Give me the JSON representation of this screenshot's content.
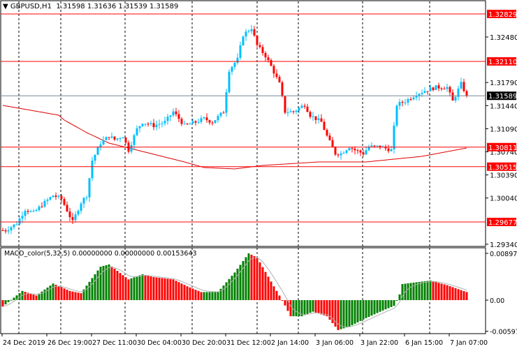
{
  "header": {
    "symbol": "GBPUSD,H1",
    "open": "1.31598",
    "high": "1.31636",
    "low": "1.31539",
    "close": "1.31589"
  },
  "indicator": {
    "label": "MACD_color(5,32,5) 0.00000000 0.00000000 0.00153643"
  },
  "colors": {
    "bull": "#00bfff",
    "bear": "#ff0000",
    "level": "#ff0000",
    "ma": "#e00000",
    "macd_up": "#008000",
    "macd_down": "#ff0000",
    "signal": "#b0b0b0",
    "current": "#778899"
  },
  "chart_data": {
    "type": "candlestick",
    "price_axis": {
      "range": [
        1.2922,
        1.3302
      ],
      "ticks": [
        "1.32480",
        "1.31790",
        "1.31440",
        "1.31090",
        "1.30740",
        "1.30390",
        "1.30040",
        "1.29340"
      ]
    },
    "levels": [
      "1.32829",
      "1.32110",
      "1.30811",
      "1.30515",
      "1.29677"
    ],
    "current_price": "1.31589",
    "price_path": [
      [
        1,
        1.2955
      ],
      [
        5,
        1.29656
      ],
      [
        8,
        1.29867
      ],
      [
        11,
        1.29815
      ],
      [
        15,
        1.29973
      ],
      [
        18,
        1.30079
      ],
      [
        21,
        1.30026
      ],
      [
        25,
        1.29677
      ],
      [
        28,
        1.29973
      ],
      [
        30,
        1.30079
      ],
      [
        32,
        1.30608
      ],
      [
        35,
        1.30872
      ],
      [
        38,
        1.30978
      ],
      [
        40,
        1.30925
      ],
      [
        43,
        1.30978
      ],
      [
        45,
        1.30766
      ],
      [
        48,
        1.31084
      ],
      [
        50,
        1.3119
      ],
      [
        54,
        1.31137
      ],
      [
        58,
        1.3119
      ],
      [
        61,
        1.31348
      ],
      [
        65,
        1.31137
      ],
      [
        69,
        1.3119
      ],
      [
        72,
        1.31242
      ],
      [
        75,
        1.3119
      ],
      [
        79,
        1.31348
      ],
      [
        81,
        1.31983
      ],
      [
        84,
        1.32141
      ],
      [
        86,
        1.32512
      ],
      [
        89,
        1.32617
      ],
      [
        91,
        1.32353
      ],
      [
        94,
        1.32194
      ],
      [
        96,
        1.32036
      ],
      [
        99,
        1.31771
      ],
      [
        101,
        1.31348
      ],
      [
        104,
        1.31348
      ],
      [
        108,
        1.31454
      ],
      [
        110,
        1.31295
      ],
      [
        114,
        1.3119
      ],
      [
        116,
        1.30978
      ],
      [
        119,
        1.30714
      ],
      [
        121,
        1.30714
      ],
      [
        124,
        1.30819
      ],
      [
        126,
        1.30766
      ],
      [
        129,
        1.30714
      ],
      [
        131,
        1.30819
      ],
      [
        135,
        1.30819
      ],
      [
        139,
        1.30766
      ],
      [
        141,
        1.31454
      ],
      [
        144,
        1.31507
      ],
      [
        148,
        1.31613
      ],
      [
        151,
        1.31666
      ],
      [
        155,
        1.31718
      ],
      [
        159,
        1.31718
      ],
      [
        161,
        1.31507
      ],
      [
        164,
        1.31771
      ],
      [
        166,
        1.31589
      ]
    ],
    "ma_path": [
      [
        0,
        1.31443
      ],
      [
        20,
        1.31295
      ],
      [
        22,
        1.31221
      ],
      [
        30,
        1.31031
      ],
      [
        38,
        1.30872
      ],
      [
        45,
        1.30798
      ],
      [
        65,
        1.30587
      ],
      [
        72,
        1.30502
      ],
      [
        83,
        1.30481
      ],
      [
        93,
        1.30534
      ],
      [
        113,
        1.30587
      ],
      [
        130,
        1.30587
      ],
      [
        150,
        1.30671
      ],
      [
        166,
        1.30798
      ]
    ],
    "macd": {
      "range": [
        -0.005971,
        0.0089706
      ],
      "ticks": [
        "0.0089706",
        "0.00",
        "-0.005971"
      ],
      "path": [
        [
          0,
          -0.00124
        ],
        [
          7,
          0.00177
        ],
        [
          12,
          0.00088
        ],
        [
          18,
          0.00318
        ],
        [
          24,
          0.00177
        ],
        [
          28,
          0.00133
        ],
        [
          35,
          0.00641
        ],
        [
          38,
          0.00685
        ],
        [
          45,
          0.00398
        ],
        [
          50,
          0.00495
        ],
        [
          54,
          0.00442
        ],
        [
          61,
          0.00398
        ],
        [
          66,
          0.00265
        ],
        [
          71,
          0.00155
        ],
        [
          77,
          0.00155
        ],
        [
          83,
          0.0053
        ],
        [
          88,
          0.00897
        ],
        [
          91,
          0.00817
        ],
        [
          97,
          0.00265
        ],
        [
          100,
          0
        ],
        [
          103,
          -0.00309
        ],
        [
          107,
          -0.00309
        ],
        [
          111,
          -0.00221
        ],
        [
          116,
          -0.00309
        ],
        [
          120,
          -0.00574
        ],
        [
          124,
          -0.00508
        ],
        [
          130,
          -0.00345
        ],
        [
          136,
          -0.00199
        ],
        [
          140,
          -0.0011
        ],
        [
          142,
          0.0011
        ],
        [
          143,
          0.00309
        ],
        [
          153,
          0.00376
        ],
        [
          159,
          0.00287
        ],
        [
          166,
          0.00155
        ]
      ]
    },
    "time_labels": [
      "24 Dec 2019",
      "26 Dec 19:00",
      "27 Dec 11:00",
      "30 Dec 04:00",
      "30 Dec 20:00",
      "31 Dec 12:00",
      "2 Jan 14:00",
      "3 Jan 06:00",
      "3 Jan 22:00",
      "6 Jan 15:00",
      "7 Jan 07:00"
    ]
  }
}
